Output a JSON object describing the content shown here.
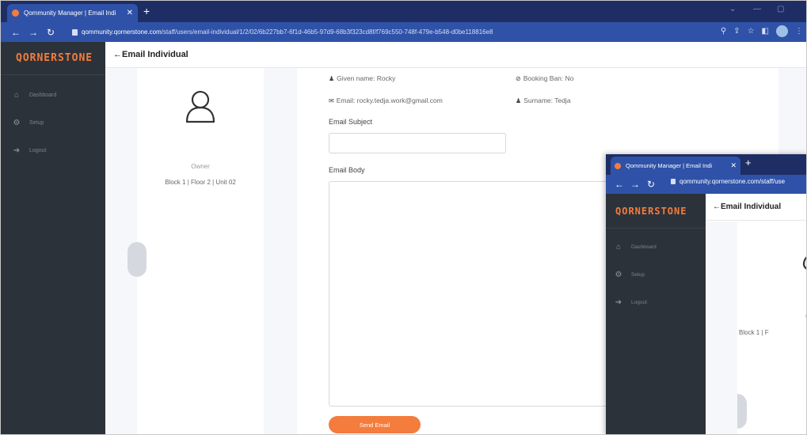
{
  "browser": {
    "tab_title": "Qommunity Manager | Email Indi",
    "url_host": "qommunity.qornerstone.com",
    "url_path": "/staff/users/email-individual/1/2/02/6b227bb7-6f1d-46b5-97d9-68b3f323cd8f/f769c550-748f-479e-b548-d0be118816e8"
  },
  "sidebar": {
    "brand": "QORNERSTONE",
    "items": [
      {
        "label": "Dashboard",
        "icon": "home-icon"
      },
      {
        "label": "Setup",
        "icon": "gear-icon"
      },
      {
        "label": "Logout",
        "icon": "logout-icon"
      }
    ]
  },
  "header": {
    "title": "Email Individual"
  },
  "profile": {
    "role": "Owner",
    "unit": "Block 1  |  Floor 2  |  Unit 02"
  },
  "details": {
    "given_name": "Given name: Rocky",
    "booking_ban": "Booking Ban: No",
    "email": "Email: rocky.tedja.work@gmail.com",
    "surname": "Surname: Tedja"
  },
  "form": {
    "subject_label": "Email Subject",
    "subject_value": "",
    "body_label": "Email Body",
    "body_value": "",
    "send_label": "Send Email"
  },
  "overlay": {
    "tab_title": "Qommunity Manager | Email Indi",
    "url": "qommunity.qornerstone.com/staff/use",
    "brand": "QORNERSTONE",
    "header": "Email Individual",
    "items": [
      "Dashboard",
      "Setup",
      "Logout"
    ],
    "role": "C",
    "unit": "Block 1  |  F"
  },
  "colors": {
    "accent": "#f47c3c",
    "sidebar": "#2c323a",
    "chrome": "#2f52a8"
  }
}
